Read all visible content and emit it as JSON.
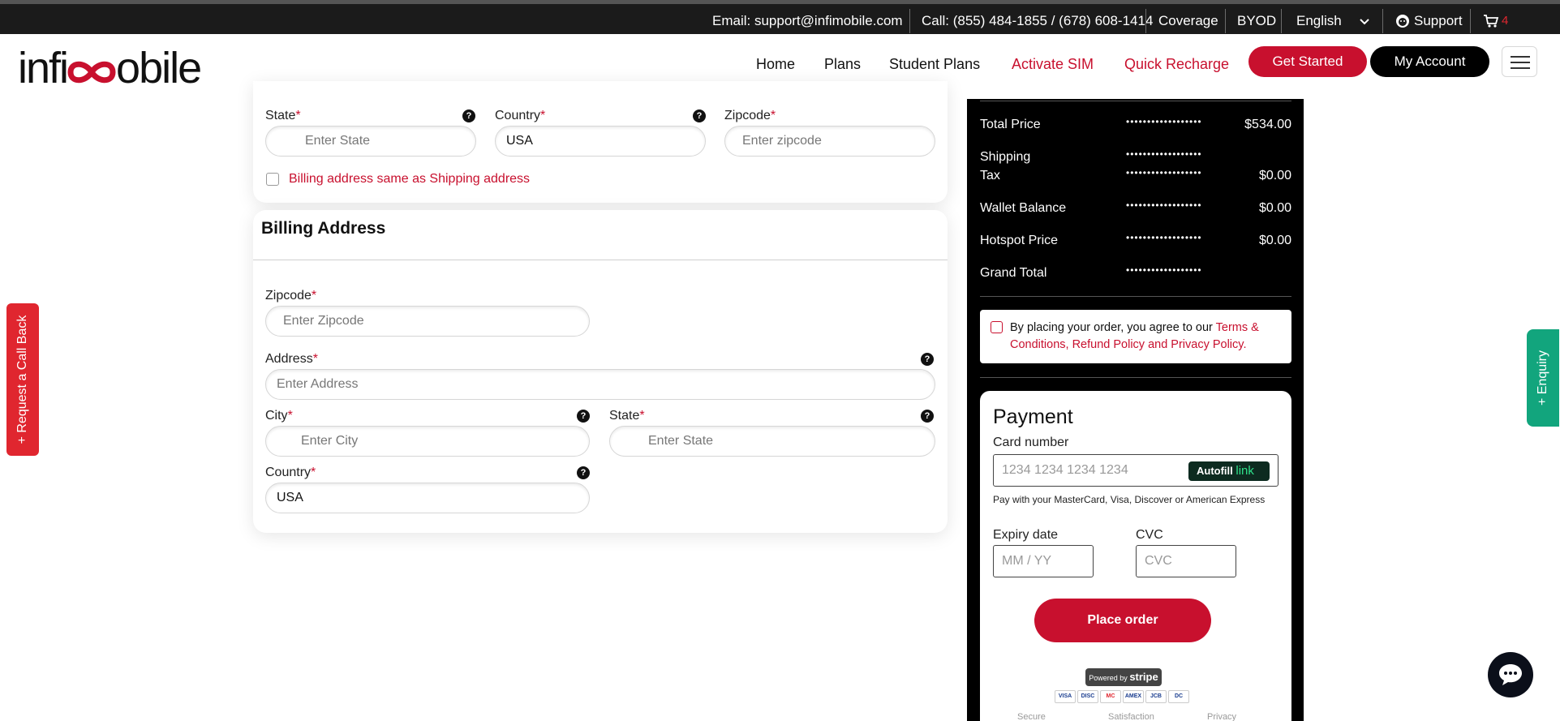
{
  "topbar": {
    "email": "Email: support@infimobile.com",
    "call": "Call: (855) 484-1855 / (678) 608-1414",
    "coverage": "Coverage",
    "byod": "BYOD",
    "language": "English",
    "support": "Support",
    "cart_count": "4"
  },
  "nav": {
    "logo_left": "infi",
    "logo_right": "obile",
    "home": "Home",
    "plans": "Plans",
    "student_plans": "Student Plans",
    "activate_sim": "Activate SIM",
    "quick_recharge": "Quick Recharge",
    "get_started": "Get Started",
    "my_account": "My Account"
  },
  "shipping": {
    "state_label": "State",
    "state_placeholder": "Enter State",
    "country_label": "Country",
    "country_value": "USA",
    "zipcode_label": "Zipcode",
    "zipcode_placeholder": "Enter zipcode",
    "same_as_shipping": "Billing address same as Shipping address"
  },
  "billing": {
    "title": "Billing Address",
    "zipcode_label": "Zipcode",
    "zipcode_placeholder": "Enter Zipcode",
    "address_label": "Address",
    "address_placeholder": "Enter Address",
    "city_label": "City",
    "city_placeholder": "Enter City",
    "state_label": "State",
    "state_placeholder": "Enter State",
    "country_label": "Country",
    "country_value": "USA"
  },
  "required_mark": "*",
  "help_glyph": "?",
  "side_tabs": {
    "callback": "+ Request a Call Back",
    "enquiry": "+ Enquiry"
  },
  "summary": {
    "dots": "••••••••••••••••••••",
    "rows": [
      {
        "label": "Total Price",
        "value": "$534.00"
      },
      {
        "label": "Shipping",
        "value": ""
      },
      {
        "label": "Tax",
        "value": "$0.00"
      },
      {
        "label": "Wallet Balance",
        "value": "$0.00"
      },
      {
        "label": "Hotspot Price",
        "value": "$0.00"
      },
      {
        "label": "Grand Total",
        "value": ""
      }
    ],
    "agree_text": "By placing your order, you agree to our ",
    "agree_link": "Terms & Conditions, Refund Policy and Privacy Policy."
  },
  "payment": {
    "title": "Payment",
    "card_number_label": "Card number",
    "card_number_placeholder": "1234 1234 1234 1234",
    "autofill": "Autofill",
    "autofill_link": "link",
    "hint": "Pay with your MasterCard, Visa, Discover or American Express",
    "expiry_label": "Expiry date",
    "expiry_placeholder": "MM / YY",
    "cvc_label": "CVC",
    "cvc_placeholder": "CVC",
    "place_order": "Place order",
    "powered_by": "Powered by",
    "stripe": "stripe",
    "card_brands": [
      "VISA",
      "DISC",
      "MC",
      "AMEX",
      "JCB",
      "DC"
    ],
    "trust": [
      "Secure",
      "Satisfaction",
      "Privacy"
    ]
  }
}
